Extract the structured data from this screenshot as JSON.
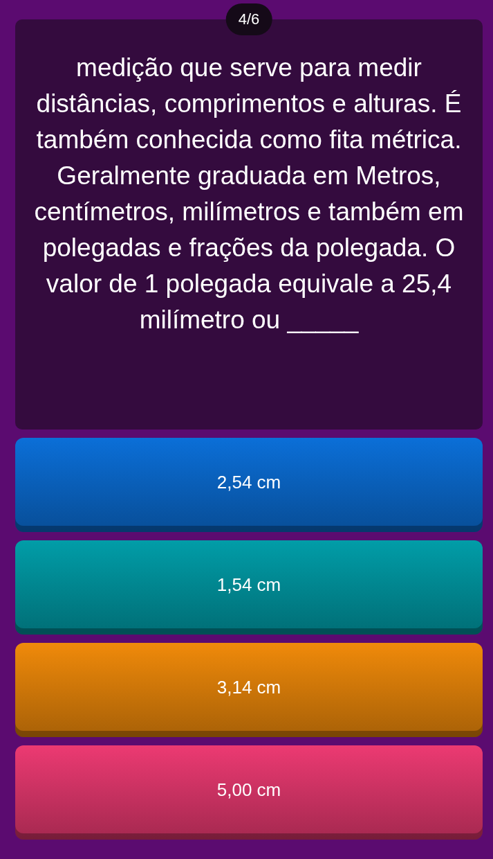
{
  "counter": "4/6",
  "question": "medição que serve para medir distâncias, comprimentos e alturas. É também conhecida como fita métrica. Geralmente graduada em Metros, centímetros, milímetros e também em polegadas e frações da polegada. O valor de 1 polegada equivale a 25,4 milímetro ou _____",
  "options": [
    {
      "label": "2,54 cm",
      "color": "#0b6fd8"
    },
    {
      "label": "1,54 cm",
      "color": "#019da8"
    },
    {
      "label": "3,14 cm",
      "color": "#f08a0a"
    },
    {
      "label": "5,00 cm",
      "color": "#ec3a72"
    }
  ]
}
